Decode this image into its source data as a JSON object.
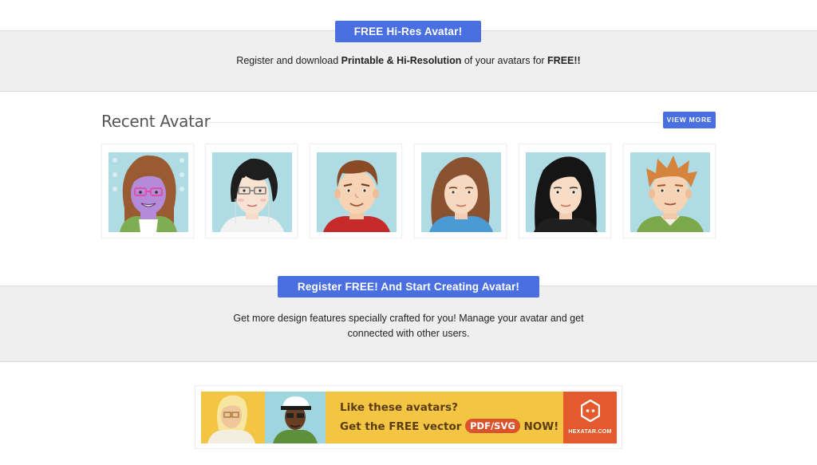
{
  "promo_top": {
    "button_label": "FREE Hi-Res Avatar!",
    "text_before": "Register and download ",
    "text_bold": "Printable & Hi-Resolution",
    "text_middle": " of your avatars for ",
    "text_bold_end": "FREE!!"
  },
  "recent": {
    "title": "Recent Avatar",
    "view_more_label": "VIEW MORE",
    "avatars": [
      {
        "hair": "brown-long",
        "skin": "purple",
        "glasses": "pink",
        "shirt": "green"
      },
      {
        "hair": "black-bob",
        "skin": "light",
        "glasses": "grey",
        "shirt": "white"
      },
      {
        "hair": "brown-short",
        "skin": "light",
        "glasses": "none",
        "shirt": "red"
      },
      {
        "hair": "brown-long",
        "skin": "light",
        "glasses": "none",
        "shirt": "blue"
      },
      {
        "hair": "black-long",
        "skin": "light",
        "glasses": "none",
        "shirt": "black"
      },
      {
        "hair": "ginger-spiky",
        "skin": "light",
        "glasses": "none",
        "shirt": "green"
      }
    ]
  },
  "promo_bottom": {
    "button_label": "Register FREE! And Start Creating Avatar!",
    "line1": "Get more design features specially crafted for you! Manage your avatar and get",
    "line2": "connected with other users."
  },
  "banner": {
    "headline": "Like these avatars?",
    "cta_before": "Get the FREE vector ",
    "cta_pill": "PDF/SVG",
    "cta_after": " NOW!",
    "brand": "HEXATAR.COM"
  },
  "colors": {
    "accent_button": "#4a6fe0",
    "band_background": "#efefef",
    "avatar_background": "#aedbe4",
    "banner_yellow": "#f4c542",
    "banner_orange": "#e4592d"
  }
}
